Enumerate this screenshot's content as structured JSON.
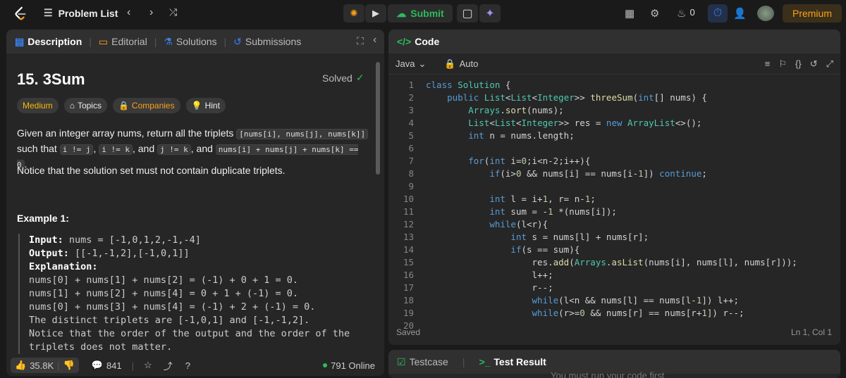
{
  "topbar": {
    "problem_list": "Problem List",
    "submit": "Submit",
    "streak": "0",
    "premium": "Premium"
  },
  "left": {
    "tabs": [
      "Description",
      "Editorial",
      "Solutions",
      "Submissions"
    ],
    "title": "15. 3Sum",
    "solved": "Solved",
    "chips": [
      "Medium",
      "Topics",
      "Companies",
      "Hint"
    ],
    "desc_a": "Given an integer array nums, return all the triplets ",
    "code1": "[nums[i], nums[j], nums[k]]",
    "desc_b": "such that ",
    "code2": "i != j",
    "comma1": ", ",
    "code3": "i != k",
    "and1": ", and ",
    "code4": "j != k",
    "and2": ", and ",
    "code5": "nums[i] + nums[j] + nums[k] == 0",
    "period": ".",
    "notice": "Notice that the solution set must not contain duplicate triplets.",
    "example_title": "Example 1:",
    "example": {
      "input_label": "Input:",
      "input_val": " nums = [-1,0,1,2,-1,-4]",
      "output_label": "Output:",
      "output_val": " [[-1,-1,2],[-1,0,1]]",
      "expl_label": "Explanation:",
      "lines": [
        "nums[0] + nums[1] + nums[2] = (-1) + 0 + 1 = 0.",
        "nums[1] + nums[2] + nums[4] = 0 + 1 + (-1) = 0.",
        "nums[0] + nums[3] + nums[4] = (-1) + 2 + (-1) = 0.",
        "The distinct triplets are [-1,0,1] and [-1,-1,2].",
        "Notice that the order of the output and the order of the",
        "triplets does not matter."
      ]
    },
    "likes": "35.8K",
    "comments": "841",
    "online": "791 Online"
  },
  "code": {
    "title": "Code",
    "lang": "Java",
    "auto": "Auto",
    "saved": "Saved",
    "cursor": "Ln 1, Col 1"
  },
  "bottom": {
    "tabs": [
      "Testcase",
      "Test Result"
    ],
    "hint": "You must run your code first"
  }
}
